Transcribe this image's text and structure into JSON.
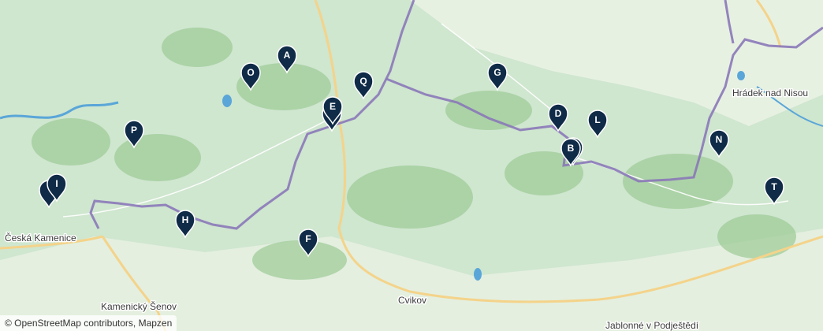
{
  "map": {
    "place_labels": [
      {
        "id": "ceska-kamenice",
        "text": "Česká Kamenice"
      },
      {
        "id": "hradek-nad-nisou",
        "text": "Hrádek nad Nisou"
      },
      {
        "id": "kamenicky-senov",
        "text": "Kamenický Šenov"
      },
      {
        "id": "cvikov",
        "text": "Cvikov"
      },
      {
        "id": "jablonne",
        "text": "Jablonné v Podještědí"
      }
    ],
    "markers": [
      {
        "letter": "A"
      },
      {
        "letter": "O"
      },
      {
        "letter": "Q"
      },
      {
        "letter": "E"
      },
      {
        "letter": "P"
      },
      {
        "letter": "I"
      },
      {
        "letter": "H"
      },
      {
        "letter": "F"
      },
      {
        "letter": "G"
      },
      {
        "letter": "D"
      },
      {
        "letter": "L"
      },
      {
        "letter": "B"
      },
      {
        "letter": "N"
      },
      {
        "letter": "T"
      }
    ],
    "marker_color": "#0f2b47",
    "border_color": "#8a78b8",
    "attribution": "© OpenStreetMap contributors, Mapzen"
  }
}
